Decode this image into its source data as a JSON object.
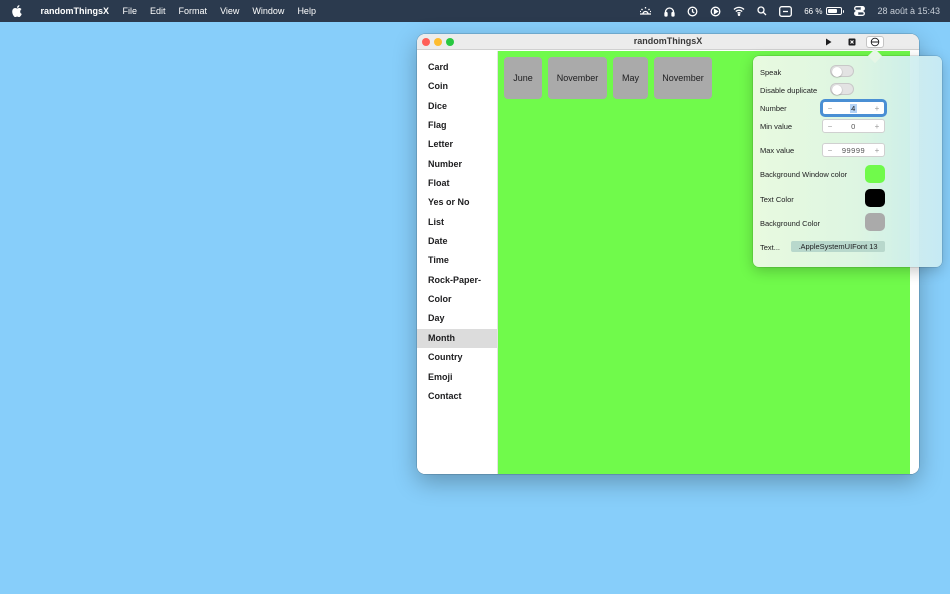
{
  "menubar": {
    "apple_icon": "apple-logo-icon",
    "app_name": "randomThingsX",
    "menus": [
      "File",
      "Edit",
      "Format",
      "View",
      "Window",
      "Help"
    ],
    "status_icons": [
      "keyboard-brightness-icon",
      "headphones-icon",
      "time-machine-icon",
      "play-circle-icon",
      "wifi-icon",
      "search-icon",
      "text-input-icon"
    ],
    "battery_percent": "66 %",
    "control_center_icon": "control-center-icon",
    "datetime": "28 août à 15:43"
  },
  "window": {
    "title": "randomThingsX",
    "toolbar": {
      "play_icon": "play-icon",
      "stop_icon": "stop-icon",
      "settings_icon": "settings-popover-icon",
      "sidebar_icon": "sidebar-toggle-icon"
    },
    "sidebar": {
      "items": [
        "Card",
        "Coin",
        "Dice",
        "Flag",
        "Letter",
        "Number",
        "Float",
        "Yes or No",
        "List",
        "Date",
        "Time",
        "Rock-Paper-",
        "Color",
        "Day",
        "Month",
        "Country",
        "Emoji",
        "Contact"
      ],
      "selected": "Month"
    },
    "content": {
      "background_color": "#70fa4b",
      "cards": [
        "June",
        "November",
        "May",
        "November"
      ]
    }
  },
  "popover": {
    "speak_label": "Speak",
    "speak_on": false,
    "disable_duplicate_label": "Disable duplicate",
    "disable_duplicate_on": false,
    "number_label": "Number",
    "number_value": "4",
    "min_label": "Min value",
    "min_value": "0",
    "max_label": "Max value",
    "max_value": "99999",
    "bg_window_color_label": "Background Window color",
    "bg_window_color": "#70fa4b",
    "text_color_label": "Text Color",
    "text_color": "#000000",
    "bg_color_label": "Background Color",
    "bg_color": "#aaaaaa",
    "text_font_label": "Text...",
    "text_font_value": ".AppleSystemUIFont 13"
  }
}
